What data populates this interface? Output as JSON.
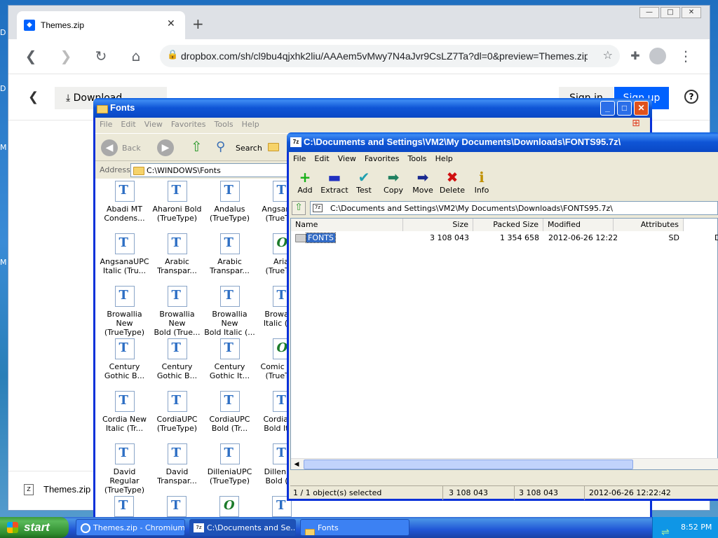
{
  "desktop": {
    "labels": [
      "D",
      "D",
      "M",
      "M"
    ]
  },
  "chrome": {
    "tab_title": "Themes.zip",
    "new_tab_symbol": "+",
    "url": "dropbox.com/sh/cl9bu4qjxhk2liu/AAAem5vMwy7N4aJvr9CsLZ7Ta?dl=0&preview=Themes.zip",
    "download_label": "Download",
    "signin_label": "Sign in",
    "signup_label": "Sign up",
    "help_symbol": "?",
    "footer_file": "Themes.zip"
  },
  "fonts_window": {
    "title": "Fonts",
    "menu": [
      "File",
      "Edit",
      "View",
      "Favorites",
      "Tools",
      "Help"
    ],
    "back_label": "Back",
    "search_label": "Search",
    "address_label": "Address",
    "address_value": "C:\\WINDOWS\\Fonts",
    "items": [
      {
        "l1": "Abadi MT",
        "l2": "Condens..."
      },
      {
        "l1": "Aharoni Bold",
        "l2": "(TrueType)"
      },
      {
        "l1": "Andalus",
        "l2": "(TrueType)"
      },
      {
        "l1": "Angsana...",
        "l2": "(TrueTy..."
      },
      {
        "l1": "AngsanaUPC",
        "l2": "Italic (Tru..."
      },
      {
        "l1": "Arabic",
        "l2": "Transpar..."
      },
      {
        "l1": "Arabic",
        "l2": "Transpar..."
      },
      {
        "l1": "Arial",
        "l2": "(TrueTy..."
      },
      {
        "l1": "Browallia New",
        "l2": "(TrueType)"
      },
      {
        "l1": "Browallia New",
        "l2": "Bold (True..."
      },
      {
        "l1": "Browallia New",
        "l2": "Bold Italic (..."
      },
      {
        "l1": "Browallia",
        "l2": "Italic (Tr..."
      },
      {
        "l1": "Century",
        "l2": "Gothic B..."
      },
      {
        "l1": "Century",
        "l2": "Gothic B..."
      },
      {
        "l1": "Century",
        "l2": "Gothic It..."
      },
      {
        "l1": "Comic Sa...",
        "l2": "(TrueTy..."
      },
      {
        "l1": "Cordia New",
        "l2": "Italic (Tr..."
      },
      {
        "l1": "CordiaUPC",
        "l2": "(TrueType)"
      },
      {
        "l1": "CordiaUPC",
        "l2": "Bold (Tr..."
      },
      {
        "l1": "CordiaU...",
        "l2": "Bold Ita..."
      },
      {
        "l1": "David Regular",
        "l2": "(TrueType)"
      },
      {
        "l1": "David",
        "l2": "Transpar..."
      },
      {
        "l1": "DilleniaUPC",
        "l2": "(TrueType)"
      },
      {
        "l1": "Dillenia...",
        "l2": "Bold (T..."
      }
    ]
  },
  "zip_window": {
    "title": "C:\\Documents and Settings\\VM2\\My Documents\\Downloads\\FONTS95.7z\\",
    "menu": [
      "File",
      "Edit",
      "View",
      "Favorites",
      "Tools",
      "Help"
    ],
    "toolbar": [
      {
        "label": "Add",
        "glyph": "+",
        "color": "#18b018"
      },
      {
        "label": "Extract",
        "glyph": "▬",
        "color": "#2030c0"
      },
      {
        "label": "Test",
        "glyph": "✔",
        "color": "#20a0b0"
      },
      {
        "label": "Copy",
        "glyph": "➡",
        "color": "#208060"
      },
      {
        "label": "Move",
        "glyph": "➡",
        "color": "#1a2a90"
      },
      {
        "label": "Delete",
        "glyph": "✖",
        "color": "#d01010"
      },
      {
        "label": "Info",
        "glyph": "ℹ",
        "color": "#c09000"
      }
    ],
    "path": "C:\\Documents and Settings\\VM2\\My Documents\\Downloads\\FONTS95.7z\\",
    "columns": [
      "Name",
      "Size",
      "Packed Size",
      "Modified",
      "Attributes"
    ],
    "rows": [
      {
        "name": "FONTS",
        "size": "3 108 043",
        "packed": "1 354 658",
        "modified": "2012-06-26 12:22",
        "attr": "SD",
        "extra": "D"
      }
    ],
    "status": [
      "1 / 1 object(s) selected",
      "3 108 043",
      "3 108 043",
      "2012-06-26 12:22:42"
    ]
  },
  "taskbar": {
    "start": "start",
    "tasks": [
      "Themes.zip - Chromium",
      "C:\\Documents and Se...",
      "Fonts"
    ],
    "clock": "8:52 PM"
  }
}
